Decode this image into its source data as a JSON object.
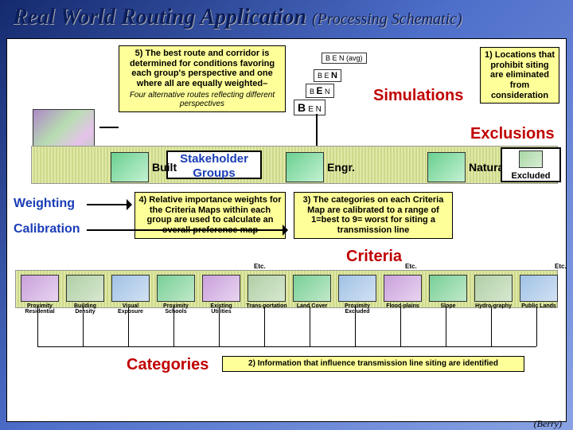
{
  "title": "Real World Routing Application",
  "subtitle": "(Processing Schematic)",
  "box1": "1) Locations that prohibit siting are eliminated from consideration",
  "label_exclusions": "Exclusions",
  "label_simulations": "Simulations",
  "sim_labels": [
    "B E N (avg)",
    "B E N",
    "B E N",
    "B E N"
  ],
  "box3": "3) The categories on each Criteria Map are calibrated to a range of 1=best to 9= worst for siting a transmission line",
  "label_criteria": "Criteria",
  "box4": "4) Relative importance weights for the Criteria Maps within each group are used to calculate an overall preference map",
  "box5_main": "5) The best route and corridor is determined for conditions favoring each group's perspective and one where all are equally weighted–",
  "box5_sub": "Four alternative routes reflecting different perspectives",
  "label_stakeholder": "Stakeholder Groups",
  "group_built": "Built",
  "group_engr": "Engr.",
  "group_natural": "Natural",
  "group_excluded": "Excluded",
  "label_weighting": "Weighting",
  "label_calibration": "Calibration",
  "label_categories": "Categories",
  "box2": "2) Information that influence transmission line siting are identified",
  "etc": "Etc.",
  "categories": [
    "Proximity Residential",
    "Building Density",
    "Visual Exposure",
    "Proximity Schools",
    "Existing Utilities",
    "Trans-portation",
    "Land Cover",
    "Proximity Excluded",
    "Flood-plains",
    "Slope",
    "Hydro-graphy",
    "Public Lands"
  ],
  "footer": "(Berry)"
}
